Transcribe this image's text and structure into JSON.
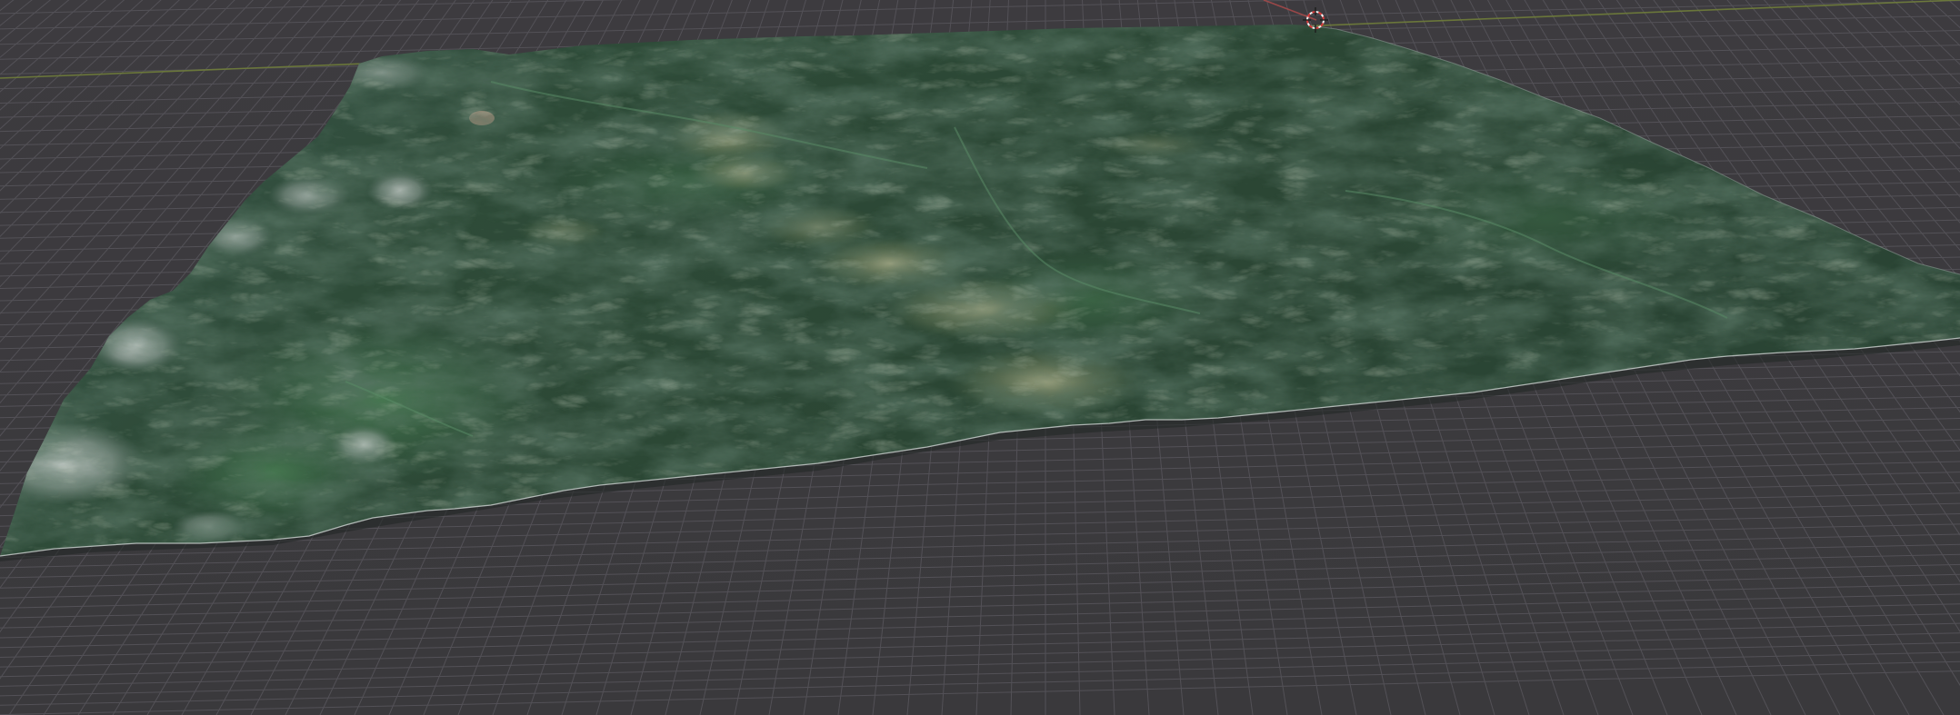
{
  "viewport": {
    "background_color": "#3c3b3e",
    "grid_line_color": "#56545a",
    "x_axis_color": "#9a4a4a",
    "y_axis_color": "#7b8a3c",
    "terrain_colors": {
      "base": "#2f4a3a",
      "forest_dark": "#1f3328",
      "valley_green": "#3c6b48",
      "ridge_highlight": "#8f9b7a",
      "snow_rock": "#c9cfcd",
      "edge_white": "#d8dcdc"
    },
    "cursor_icon": "3d-cursor-icon",
    "object": "terrain-mesh"
  }
}
